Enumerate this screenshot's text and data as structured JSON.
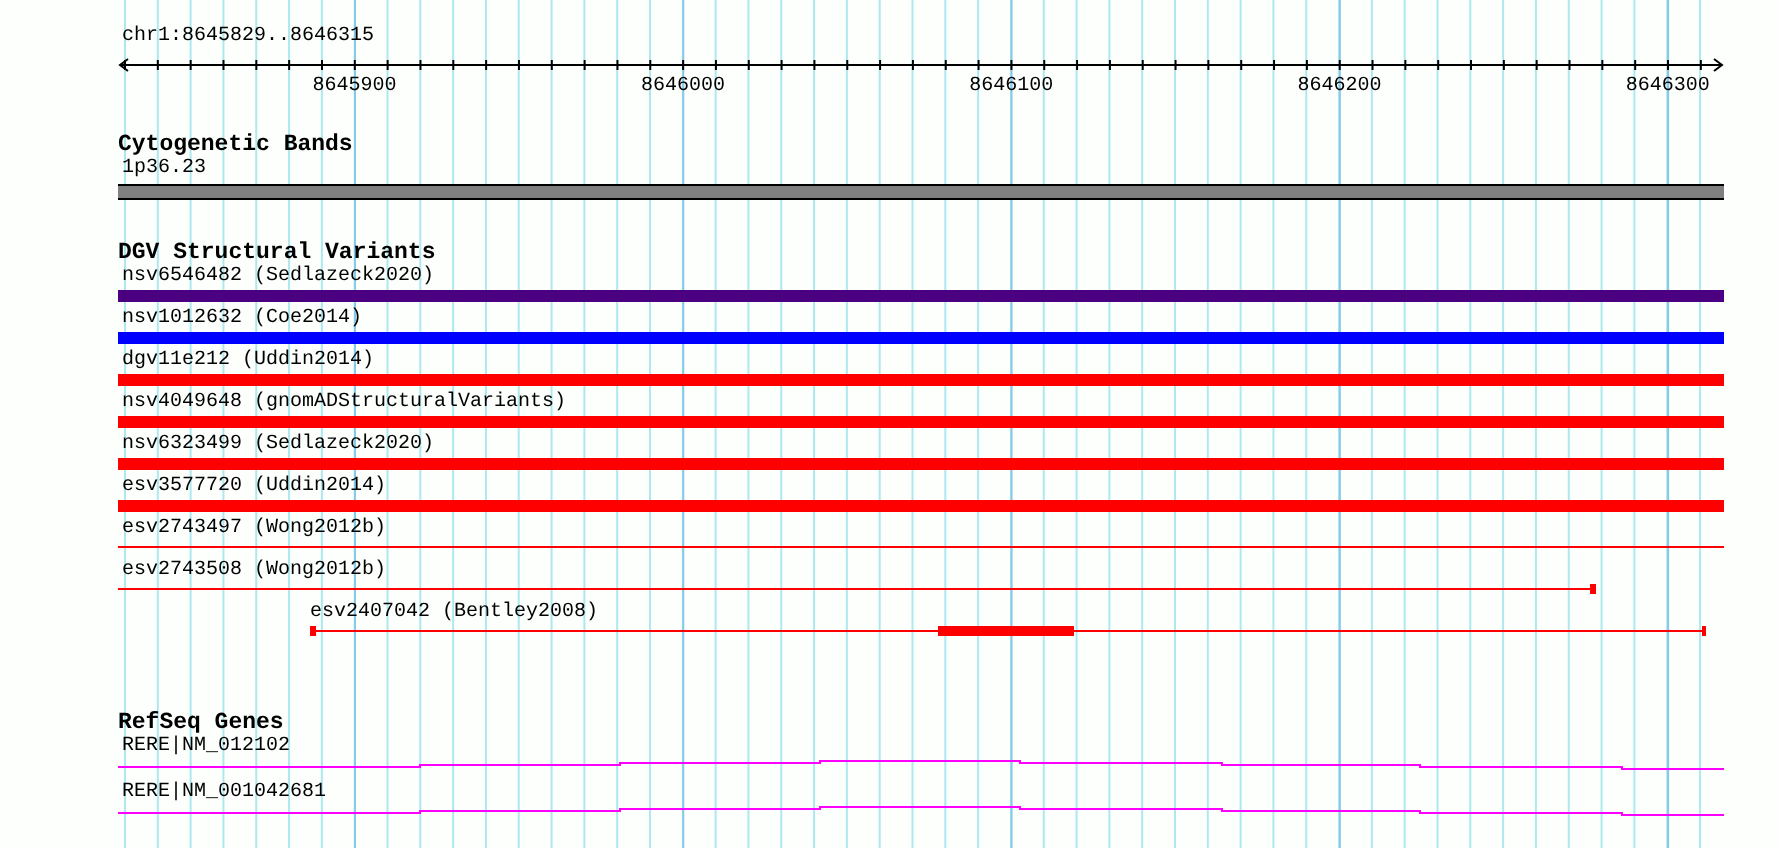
{
  "region": "chr1:8645829..8646315",
  "ruler": {
    "labels": [
      "8645900",
      "8646000",
      "8646100",
      "8646200",
      "8646300"
    ]
  },
  "tracks": [
    {
      "kind": "bands",
      "title": "Cytogenetic Bands",
      "features": [
        {
          "label": "1p36.23"
        }
      ]
    },
    {
      "kind": "variants",
      "title": "DGV Structural Variants",
      "features": [
        {
          "label": "nsv6546482 (Sedlazeck2020)",
          "kind": "full",
          "color": "#4b0082"
        },
        {
          "label": "nsv1012632 (Coe2014)",
          "kind": "full",
          "color": "#0000ff"
        },
        {
          "label": "dgv11e212 (Uddin2014)",
          "kind": "full",
          "color": "#ff0000"
        },
        {
          "label": "nsv4049648 (gnomADStructuralVariants)",
          "kind": "full",
          "color": "#ff0000"
        },
        {
          "label": "nsv6323499 (Sedlazeck2020)",
          "kind": "full",
          "color": "#ff0000"
        },
        {
          "label": "esv3577720 (Uddin2014)",
          "kind": "full",
          "color": "#ff0000"
        },
        {
          "label": "esv2743497 (Wong2012b)",
          "kind": "line",
          "color": "#ff0000"
        },
        {
          "label": "esv2743508 (Wong2012b)",
          "kind": "line-marker",
          "color": "#ff0000"
        },
        {
          "label": "esv2407042 (Bentley2008)",
          "kind": "split",
          "color": "#ff0000"
        }
      ]
    },
    {
      "kind": "genes",
      "title": "RefSeq Genes",
      "features": [
        {
          "label": "RERE|NM_012102"
        },
        {
          "label": "RERE|NM_001042681"
        }
      ]
    }
  ]
}
